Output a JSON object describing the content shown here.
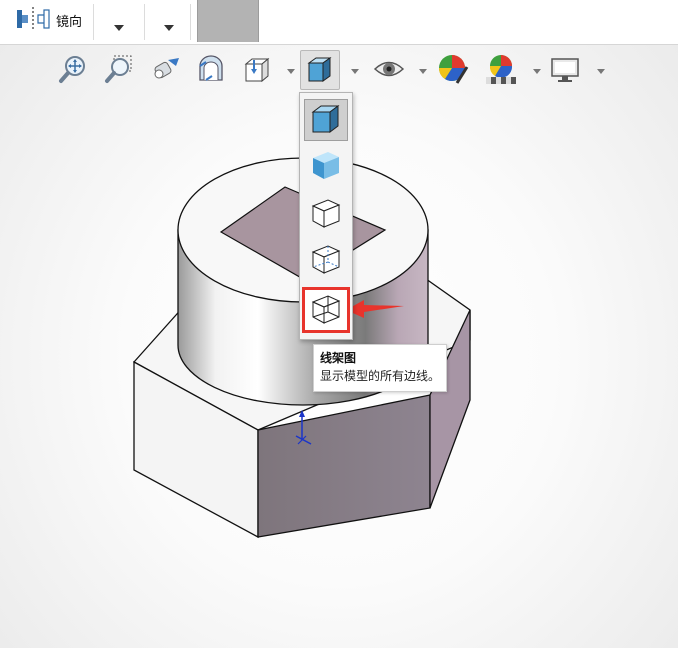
{
  "toolbar": {
    "mirror_label": "镜向",
    "mirror_icon": "mirror-icon",
    "swatch_color": "#b3b3b3"
  },
  "hud": {
    "items": [
      {
        "name": "zoom-to-fit-icon"
      },
      {
        "name": "zoom-to-area-icon"
      },
      {
        "name": "previous-view-icon"
      },
      {
        "name": "section-view-icon"
      },
      {
        "name": "view-orientation-icon"
      },
      {
        "name": "display-style-icon",
        "active": true
      },
      {
        "name": "hide-show-items-icon"
      },
      {
        "name": "edit-appearance-icon"
      },
      {
        "name": "apply-scene-icon"
      },
      {
        "name": "view-settings-icon"
      }
    ]
  },
  "display_style_menu": {
    "options": [
      {
        "name": "shaded-with-edges-icon",
        "selected": true
      },
      {
        "name": "shaded-icon"
      },
      {
        "name": "hidden-lines-removed-icon"
      },
      {
        "name": "hidden-lines-visible-icon"
      },
      {
        "name": "wireframe-icon",
        "highlighted": true
      }
    ]
  },
  "tooltip": {
    "title": "线架图",
    "description": "显示模型的所有边线。"
  },
  "colors": {
    "highlight_red": "#e8342c",
    "model_face_purple": "#a4919f",
    "cube_blue": "#4fa3d6"
  }
}
